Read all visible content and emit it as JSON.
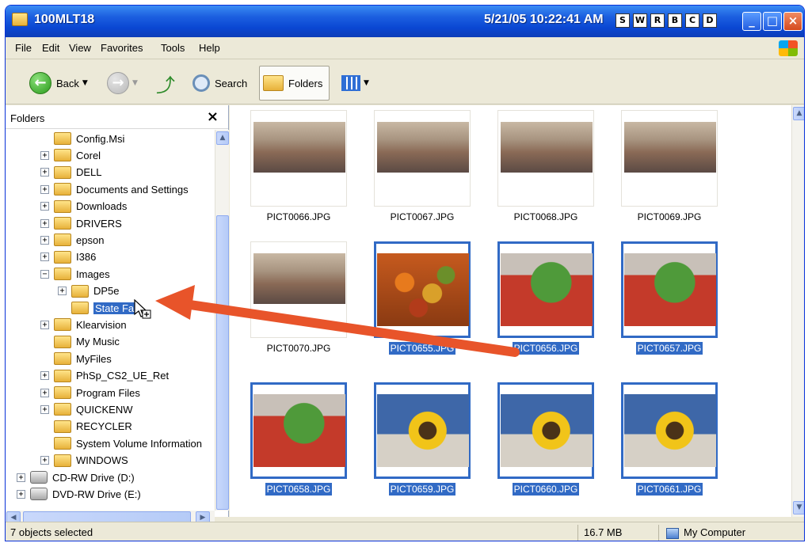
{
  "window": {
    "title": "100MLT18",
    "clock": "5/21/05 10:22:41 AM",
    "small_buttons": [
      "S",
      "W",
      "R",
      "B",
      "C",
      "D"
    ],
    "controls": {
      "minimize": "_",
      "maximize": "□",
      "close": "×"
    }
  },
  "menubar": {
    "items": [
      "File",
      "Edit",
      "View",
      "Favorites",
      "Tools",
      "Help"
    ]
  },
  "toolbar": {
    "back_label": "Back",
    "search_label": "Search",
    "folders_label": "Folders"
  },
  "folders_panel": {
    "title": "Folders",
    "close": "×",
    "tree": [
      {
        "label": "Config.Msi",
        "expander": "",
        "type": "folder",
        "level": 1
      },
      {
        "label": "Corel",
        "expander": "+",
        "type": "folder",
        "level": 1
      },
      {
        "label": "DELL",
        "expander": "+",
        "type": "folder",
        "level": 1
      },
      {
        "label": "Documents and Settings",
        "expander": "+",
        "type": "folder",
        "level": 1
      },
      {
        "label": "Downloads",
        "expander": "+",
        "type": "folder",
        "level": 1
      },
      {
        "label": "DRIVERS",
        "expander": "+",
        "type": "folder",
        "level": 1
      },
      {
        "label": "epson",
        "expander": "+",
        "type": "folder",
        "level": 1
      },
      {
        "label": "I386",
        "expander": "+",
        "type": "folder",
        "level": 1
      },
      {
        "label": "Images",
        "expander": "−",
        "type": "folder",
        "level": 1
      },
      {
        "label": "DP5e",
        "expander": "+",
        "type": "folder",
        "level": 2
      },
      {
        "label": "State Fa",
        "expander": "",
        "type": "folder",
        "level": 2,
        "selected": true
      },
      {
        "label": "Klearvision",
        "expander": "+",
        "type": "folder",
        "level": 1
      },
      {
        "label": "My Music",
        "expander": "",
        "type": "folder",
        "level": 1
      },
      {
        "label": "MyFiles",
        "expander": "",
        "type": "folder",
        "level": 1
      },
      {
        "label": "PhSp_CS2_UE_Ret",
        "expander": "+",
        "type": "folder",
        "level": 1
      },
      {
        "label": "Program Files",
        "expander": "+",
        "type": "folder",
        "level": 1
      },
      {
        "label": "QUICKENW",
        "expander": "+",
        "type": "folder",
        "level": 1
      },
      {
        "label": "RECYCLER",
        "expander": "",
        "type": "folder",
        "level": 1
      },
      {
        "label": "System Volume Information",
        "expander": "",
        "type": "folder",
        "level": 1
      },
      {
        "label": "WINDOWS",
        "expander": "+",
        "type": "folder",
        "level": 1
      },
      {
        "label": "CD-RW Drive (D:)",
        "expander": "+",
        "type": "drive",
        "level": 0
      },
      {
        "label": "DVD-RW Drive (E:)",
        "expander": "+",
        "type": "drive",
        "level": 0
      }
    ]
  },
  "thumbnails": [
    {
      "name": "PICT0066.JPG",
      "selected": false,
      "kind": "sky"
    },
    {
      "name": "PICT0067.JPG",
      "selected": false,
      "kind": "sky"
    },
    {
      "name": "PICT0068.JPG",
      "selected": false,
      "kind": "sky"
    },
    {
      "name": "PICT0069.JPG",
      "selected": false,
      "kind": "sky"
    },
    {
      "name": "PICT0070.JPG",
      "selected": false,
      "kind": "sky"
    },
    {
      "name": "PICT0655.JPG",
      "selected": true,
      "kind": "gourd"
    },
    {
      "name": "PICT0656.JPG",
      "selected": true,
      "kind": "planter"
    },
    {
      "name": "PICT0657.JPG",
      "selected": true,
      "kind": "planter"
    },
    {
      "name": "PICT0658.JPG",
      "selected": true,
      "kind": "planter"
    },
    {
      "name": "PICT0659.JPG",
      "selected": true,
      "kind": "sunflower"
    },
    {
      "name": "PICT0660.JPG",
      "selected": true,
      "kind": "sunflower"
    },
    {
      "name": "PICT0661.JPG",
      "selected": true,
      "kind": "sunflower"
    }
  ],
  "statusbar": {
    "selection": "7 objects selected",
    "size": "16.7 MB",
    "location": "My Computer"
  },
  "icons": {
    "title": "folder-icon",
    "back": "back-arrow-icon",
    "forward": "forward-arrow-icon",
    "up": "up-folder-icon",
    "search": "search-icon",
    "folders": "folders-icon",
    "views": "views-icon",
    "drag": "drag-copy-cursor-icon",
    "computer": "my-computer-icon"
  },
  "colors": {
    "selection": "#316ac5",
    "titlebar": "#0a47d3",
    "drag_arrow": "#e8542a"
  }
}
